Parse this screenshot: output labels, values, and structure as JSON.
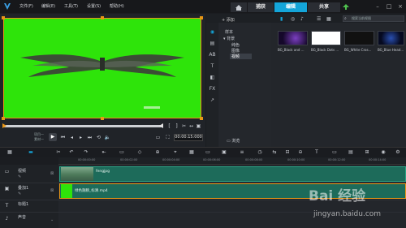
{
  "app": {
    "menu": [
      {
        "label": "文件(F)"
      },
      {
        "label": "编辑(E)"
      },
      {
        "label": "工具(T)"
      },
      {
        "label": "设置(S)"
      },
      {
        "label": "帮助(H)"
      }
    ],
    "workspace_tabs": [
      "捕获",
      "编辑",
      "共享"
    ],
    "active_tab": "编辑",
    "accent": "#14a5d9"
  },
  "player": {
    "mode_labels": [
      "项目—",
      "素材—"
    ],
    "timecode": "00:00:15:000",
    "preview_bg": "#2ee40a",
    "handle_color": "#e89616"
  },
  "library": {
    "add_label": "添加",
    "tree": [
      {
        "label": "样本"
      },
      {
        "label": "背景"
      },
      {
        "label": "纯色"
      },
      {
        "label": "图像"
      },
      {
        "label": "视频"
      }
    ],
    "search_placeholder": "搜索当前视图",
    "thumbnails": [
      {
        "label": "BG_Black and ..."
      },
      {
        "label": "BG_Black Dots ..."
      },
      {
        "label": "BG_White Cros..."
      },
      {
        "label": "BG_Blue Head..."
      }
    ],
    "browse_label": "浏览"
  },
  "timeline": {
    "ruler_ticks": [
      "00:00:00:00",
      "00:00:02:00",
      "00:00:04:00",
      "00:00:06:00",
      "00:00:08:00",
      "00:00:10:00",
      "00:00:12:00",
      "00:00:14:00"
    ],
    "tracks": [
      {
        "name": "视频"
      },
      {
        "name": "叠加1"
      },
      {
        "name": "标题1"
      },
      {
        "name": "声音"
      }
    ],
    "clips": {
      "video": "fengjpg",
      "overlay": "绿色翅膀_标清.mp4"
    }
  },
  "watermark": {
    "brand": "Bai 经验",
    "url": "jingyan.baidu.com"
  }
}
